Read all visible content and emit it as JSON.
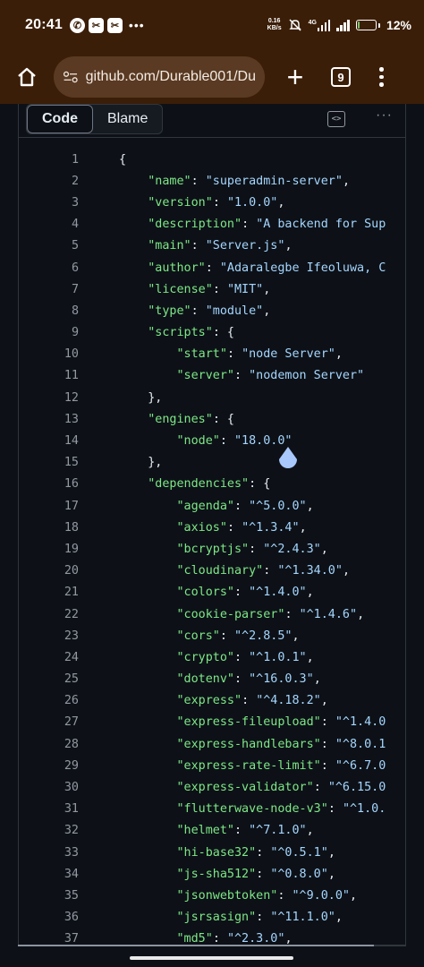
{
  "status_bar": {
    "time": "20:41",
    "net_speed_value": "0.16",
    "net_speed_unit": "KB/s",
    "battery_percent": "12%",
    "battery_level": 0.12,
    "network_label": "4G"
  },
  "browser": {
    "url": "github.com/Durable001/Du",
    "tab_count": "9"
  },
  "code_view": {
    "tabs": [
      "Code",
      "Blame"
    ],
    "active_tab": "Code",
    "lines": [
      {
        "n": "1",
        "indent": 0,
        "parts": [
          [
            "p",
            "{"
          ]
        ]
      },
      {
        "n": "2",
        "indent": 1,
        "parts": [
          [
            "k",
            "\"name\""
          ],
          [
            "p",
            ": "
          ],
          [
            "s",
            "\"superadmin-server\""
          ],
          [
            "p",
            ","
          ]
        ]
      },
      {
        "n": "3",
        "indent": 1,
        "parts": [
          [
            "k",
            "\"version\""
          ],
          [
            "p",
            ": "
          ],
          [
            "s",
            "\"1.0.0\""
          ],
          [
            "p",
            ","
          ]
        ]
      },
      {
        "n": "4",
        "indent": 1,
        "parts": [
          [
            "k",
            "\"description\""
          ],
          [
            "p",
            ": "
          ],
          [
            "s",
            "\"A backend for Sup"
          ]
        ]
      },
      {
        "n": "5",
        "indent": 1,
        "parts": [
          [
            "k",
            "\"main\""
          ],
          [
            "p",
            ": "
          ],
          [
            "s",
            "\"Server.js\""
          ],
          [
            "p",
            ","
          ]
        ]
      },
      {
        "n": "6",
        "indent": 1,
        "parts": [
          [
            "k",
            "\"author\""
          ],
          [
            "p",
            ": "
          ],
          [
            "s",
            "\"Adaralegbe Ifeoluwa, C"
          ]
        ]
      },
      {
        "n": "7",
        "indent": 1,
        "parts": [
          [
            "k",
            "\"license\""
          ],
          [
            "p",
            ": "
          ],
          [
            "s",
            "\"MIT\""
          ],
          [
            "p",
            ","
          ]
        ]
      },
      {
        "n": "8",
        "indent": 1,
        "parts": [
          [
            "k",
            "\"type\""
          ],
          [
            "p",
            ": "
          ],
          [
            "s",
            "\"module\""
          ],
          [
            "p",
            ","
          ]
        ]
      },
      {
        "n": "9",
        "indent": 1,
        "parts": [
          [
            "k",
            "\"scripts\""
          ],
          [
            "p",
            ": {"
          ]
        ]
      },
      {
        "n": "10",
        "indent": 2,
        "parts": [
          [
            "k",
            "\"start\""
          ],
          [
            "p",
            ": "
          ],
          [
            "s",
            "\"node Server\""
          ],
          [
            "p",
            ","
          ]
        ]
      },
      {
        "n": "11",
        "indent": 2,
        "parts": [
          [
            "k",
            "\"server\""
          ],
          [
            "p",
            ": "
          ],
          [
            "s",
            "\"nodemon Server\""
          ]
        ]
      },
      {
        "n": "12",
        "indent": 1,
        "parts": [
          [
            "p",
            "},"
          ]
        ]
      },
      {
        "n": "13",
        "indent": 1,
        "parts": [
          [
            "k",
            "\"engines\""
          ],
          [
            "p",
            ": {"
          ]
        ]
      },
      {
        "n": "14",
        "indent": 2,
        "parts": [
          [
            "k",
            "\"node\""
          ],
          [
            "p",
            ": "
          ],
          [
            "s",
            "\"18.0.0\""
          ]
        ]
      },
      {
        "n": "15",
        "indent": 1,
        "parts": [
          [
            "p",
            "},"
          ]
        ]
      },
      {
        "n": "16",
        "indent": 1,
        "parts": [
          [
            "k",
            "\"dependencies\""
          ],
          [
            "p",
            ": {"
          ]
        ]
      },
      {
        "n": "17",
        "indent": 2,
        "parts": [
          [
            "k",
            "\"agenda\""
          ],
          [
            "p",
            ": "
          ],
          [
            "s",
            "\"^5.0.0\""
          ],
          [
            "p",
            ","
          ]
        ]
      },
      {
        "n": "18",
        "indent": 2,
        "parts": [
          [
            "k",
            "\"axios\""
          ],
          [
            "p",
            ": "
          ],
          [
            "s",
            "\"^1.3.4\""
          ],
          [
            "p",
            ","
          ]
        ]
      },
      {
        "n": "19",
        "indent": 2,
        "parts": [
          [
            "k",
            "\"bcryptjs\""
          ],
          [
            "p",
            ": "
          ],
          [
            "s",
            "\"^2.4.3\""
          ],
          [
            "p",
            ","
          ]
        ]
      },
      {
        "n": "20",
        "indent": 2,
        "parts": [
          [
            "k",
            "\"cloudinary\""
          ],
          [
            "p",
            ": "
          ],
          [
            "s",
            "\"^1.34.0\""
          ],
          [
            "p",
            ","
          ]
        ]
      },
      {
        "n": "21",
        "indent": 2,
        "parts": [
          [
            "k",
            "\"colors\""
          ],
          [
            "p",
            ": "
          ],
          [
            "s",
            "\"^1.4.0\""
          ],
          [
            "p",
            ","
          ]
        ]
      },
      {
        "n": "22",
        "indent": 2,
        "parts": [
          [
            "k",
            "\"cookie-parser\""
          ],
          [
            "p",
            ": "
          ],
          [
            "s",
            "\"^1.4.6\""
          ],
          [
            "p",
            ","
          ]
        ]
      },
      {
        "n": "23",
        "indent": 2,
        "parts": [
          [
            "k",
            "\"cors\""
          ],
          [
            "p",
            ": "
          ],
          [
            "s",
            "\"^2.8.5\""
          ],
          [
            "p",
            ","
          ]
        ]
      },
      {
        "n": "24",
        "indent": 2,
        "parts": [
          [
            "k",
            "\"crypto\""
          ],
          [
            "p",
            ": "
          ],
          [
            "s",
            "\"^1.0.1\""
          ],
          [
            "p",
            ","
          ]
        ]
      },
      {
        "n": "25",
        "indent": 2,
        "parts": [
          [
            "k",
            "\"dotenv\""
          ],
          [
            "p",
            ": "
          ],
          [
            "s",
            "\"^16.0.3\""
          ],
          [
            "p",
            ","
          ]
        ]
      },
      {
        "n": "26",
        "indent": 2,
        "parts": [
          [
            "k",
            "\"express\""
          ],
          [
            "p",
            ": "
          ],
          [
            "s",
            "\"^4.18.2\""
          ],
          [
            "p",
            ","
          ]
        ]
      },
      {
        "n": "27",
        "indent": 2,
        "parts": [
          [
            "k",
            "\"express-fileupload\""
          ],
          [
            "p",
            ": "
          ],
          [
            "s",
            "\"^1.4.0"
          ]
        ]
      },
      {
        "n": "28",
        "indent": 2,
        "parts": [
          [
            "k",
            "\"express-handlebars\""
          ],
          [
            "p",
            ": "
          ],
          [
            "s",
            "\"^8.0.1"
          ]
        ]
      },
      {
        "n": "29",
        "indent": 2,
        "parts": [
          [
            "k",
            "\"express-rate-limit\""
          ],
          [
            "p",
            ": "
          ],
          [
            "s",
            "\"^6.7.0"
          ]
        ]
      },
      {
        "n": "30",
        "indent": 2,
        "parts": [
          [
            "k",
            "\"express-validator\""
          ],
          [
            "p",
            ": "
          ],
          [
            "s",
            "\"^6.15.0"
          ]
        ]
      },
      {
        "n": "31",
        "indent": 2,
        "parts": [
          [
            "k",
            "\"flutterwave-node-v3\""
          ],
          [
            "p",
            ": "
          ],
          [
            "s",
            "\"^1.0."
          ]
        ]
      },
      {
        "n": "32",
        "indent": 2,
        "parts": [
          [
            "k",
            "\"helmet\""
          ],
          [
            "p",
            ": "
          ],
          [
            "s",
            "\"^7.1.0\""
          ],
          [
            "p",
            ","
          ]
        ]
      },
      {
        "n": "33",
        "indent": 2,
        "parts": [
          [
            "k",
            "\"hi-base32\""
          ],
          [
            "p",
            ": "
          ],
          [
            "s",
            "\"^0.5.1\""
          ],
          [
            "p",
            ","
          ]
        ]
      },
      {
        "n": "34",
        "indent": 2,
        "parts": [
          [
            "k",
            "\"js-sha512\""
          ],
          [
            "p",
            ": "
          ],
          [
            "s",
            "\"^0.8.0\""
          ],
          [
            "p",
            ","
          ]
        ]
      },
      {
        "n": "35",
        "indent": 2,
        "parts": [
          [
            "k",
            "\"jsonwebtoken\""
          ],
          [
            "p",
            ": "
          ],
          [
            "s",
            "\"^9.0.0\""
          ],
          [
            "p",
            ","
          ]
        ]
      },
      {
        "n": "36",
        "indent": 2,
        "parts": [
          [
            "k",
            "\"jsrsasign\""
          ],
          [
            "p",
            ": "
          ],
          [
            "s",
            "\"^11.1.0\""
          ],
          [
            "p",
            ","
          ]
        ]
      },
      {
        "n": "37",
        "indent": 2,
        "parts": [
          [
            "k",
            "\"md5\""
          ],
          [
            "p",
            ": "
          ],
          [
            "s",
            "\"^2.3.0\""
          ],
          [
            "p",
            ","
          ]
        ]
      }
    ]
  },
  "colors": {
    "status_bar_bg": "#3b1e08",
    "code_bg": "#0d1117",
    "key_color": "#7ee787",
    "string_color": "#a5d6ff",
    "line_number_color": "#9198a1"
  }
}
